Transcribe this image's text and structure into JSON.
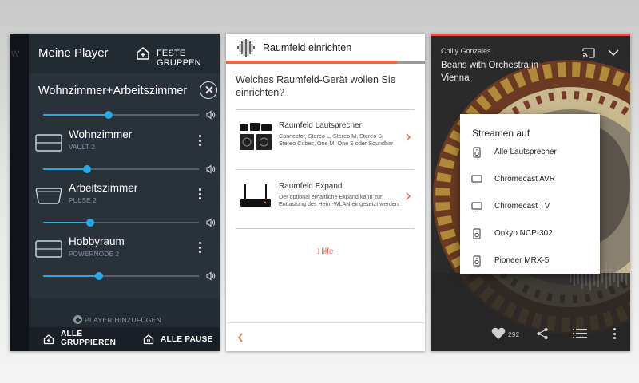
{
  "screen1": {
    "edge_text": "W",
    "title": "Meine Player",
    "fixed_groups_label": "FESTE GRUPPEN",
    "group": {
      "name": "Wohnzimmer+Arbeitszimmer",
      "volume": 0.42
    },
    "rooms": [
      {
        "name": "Wohnzimmer",
        "model": "VAULT 2",
        "volume": 0.28,
        "icon": "box-speaker-icon"
      },
      {
        "name": "Arbeitszimmer",
        "model": "PULSE 2",
        "volume": 0.3,
        "icon": "pulse-speaker-icon"
      },
      {
        "name": "Hobbyraum",
        "model": "POWERNODE 2",
        "volume": 0.36,
        "icon": "box-speaker-icon"
      }
    ],
    "add_player_label": "PLAYER HINZUFÜGEN",
    "group_all_label_line1": "ALLE",
    "group_all_label_line2": "GRUPPIEREN",
    "pause_all_label": "ALLE PAUSE"
  },
  "screen2": {
    "title": "Raumfeld einrichten",
    "progress": 0.86,
    "question": "Welches Raumfeld-Gerät wollen Sie einrichten?",
    "options": [
      {
        "title": "Raumfeld Lautsprecher",
        "description": "Connector, Stereo L, Stereo M, Stereo S, Stereo Cubes, One M, One S oder Soundbar"
      },
      {
        "title": "Raumfeld Expand",
        "description": "Der optional erhältliche Expand kann zur Entlastung des Heim-WLAN eingesetzt werden."
      }
    ],
    "help_label": "Hilfe"
  },
  "screen3": {
    "artist": "Chilly Gonzales.",
    "track": "Beans with Orchestra in Vienna",
    "dialog_title": "Streamen auf",
    "targets": [
      {
        "label": "Alle Lautsprecher",
        "icon": "speaker-icon"
      },
      {
        "label": "Chromecast AVR",
        "icon": "tv-icon"
      },
      {
        "label": "Chromecast TV",
        "icon": "tv-icon"
      },
      {
        "label": "Onkyo NCP-302",
        "icon": "speaker-icon"
      },
      {
        "label": "Pioneer MRX-5",
        "icon": "speaker-icon"
      }
    ],
    "likes": "292",
    "accent_color": "#d9543a"
  }
}
